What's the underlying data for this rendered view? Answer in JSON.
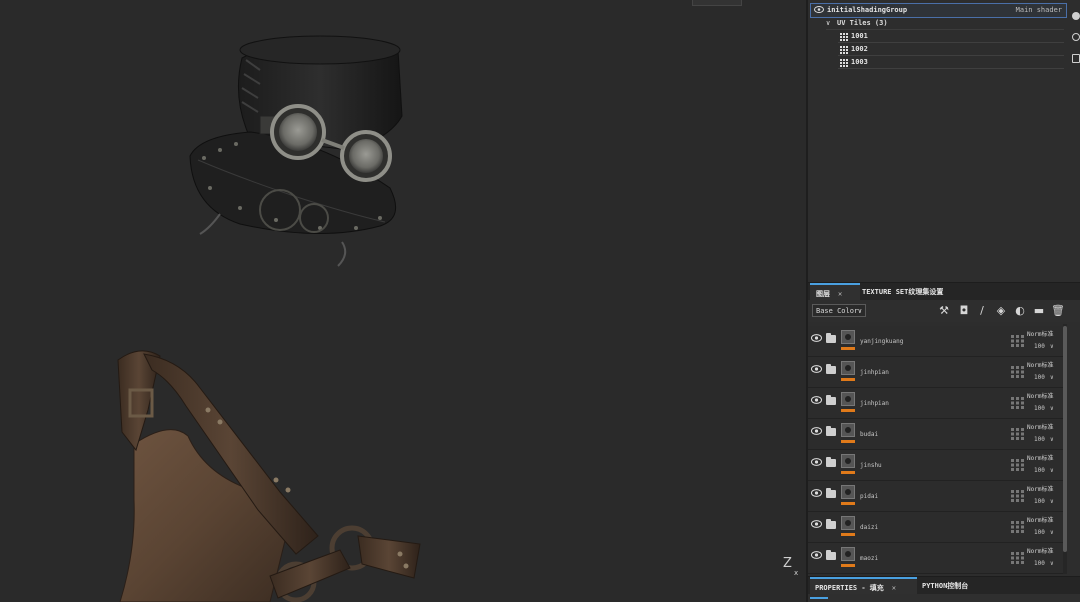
{
  "shader": {
    "group_name": "initialShadingGroup",
    "shader_type": "Main shader",
    "uv_tiles_label": "UV Tiles (3)",
    "tiles": [
      "1001",
      "1002",
      "1003"
    ]
  },
  "tabs": {
    "layers_tab": "图层",
    "texture_set_tab": "TEXTURE SET纹理集设置",
    "close_glyph": "✕"
  },
  "toolbar": {
    "channel_select": "Base Color"
  },
  "layers": [
    {
      "name": "yanjingkuang",
      "blend": "Norm标准",
      "opacity": "100"
    },
    {
      "name": "jinhpian",
      "blend": "Norm标准",
      "opacity": "100"
    },
    {
      "name": "jinhpian",
      "blend": "Norm标准",
      "opacity": "100"
    },
    {
      "name": "budai",
      "blend": "Norm标准",
      "opacity": "100"
    },
    {
      "name": "jinshu",
      "blend": "Norm标准",
      "opacity": "100"
    },
    {
      "name": "pidai",
      "blend": "Norm标准",
      "opacity": "100"
    },
    {
      "name": "daizi",
      "blend": "Norm标准",
      "opacity": "100"
    },
    {
      "name": "maozi",
      "blend": "Norm标准",
      "opacity": "100"
    }
  ],
  "bottom_tabs": {
    "properties_tab": "PROPERTIES - 填充",
    "python_tab": "PYTHON控制台"
  },
  "viewport": {
    "axis_z": "Z",
    "axis_x": "x"
  },
  "colors": {
    "accent_blue": "#4aa0e0",
    "layer_orange": "#e07a1a"
  }
}
